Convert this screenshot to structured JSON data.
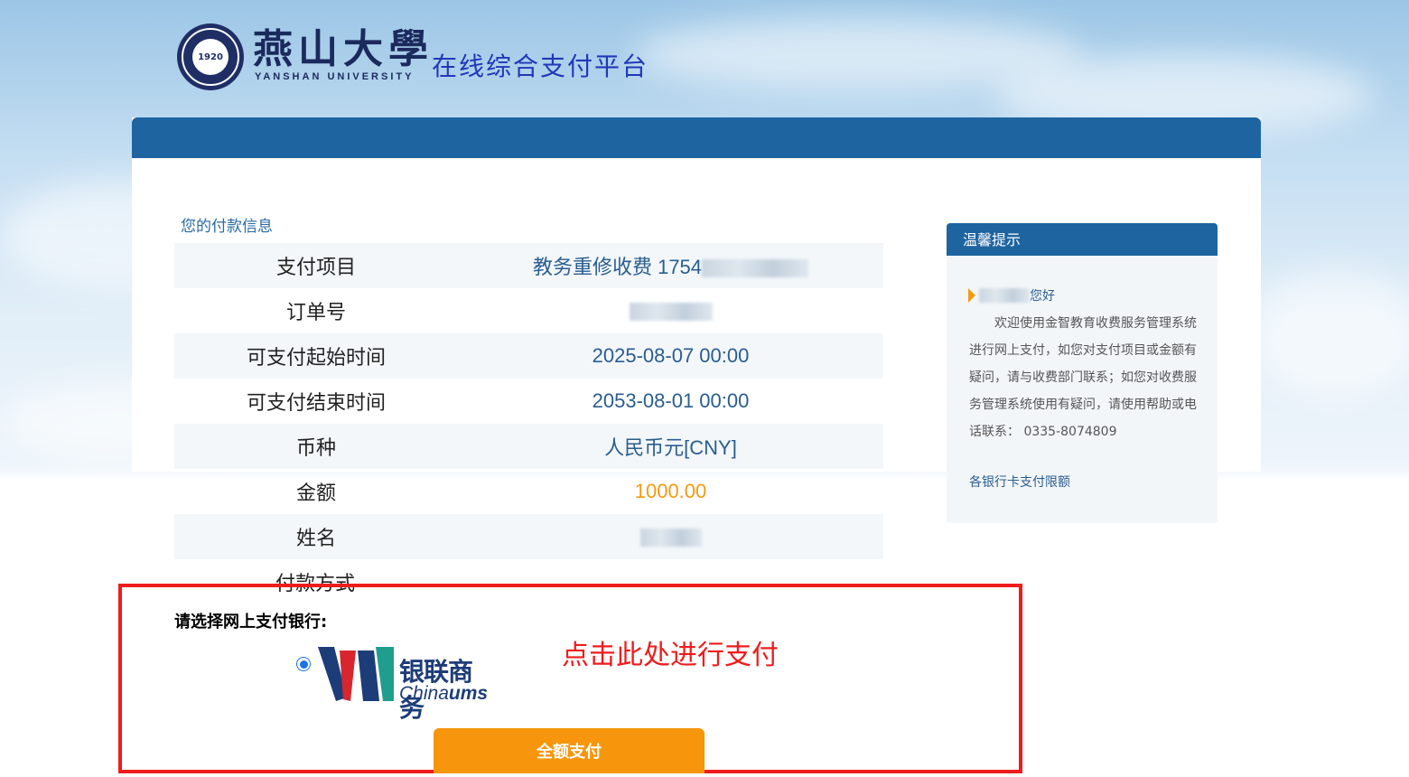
{
  "header": {
    "logo_cn": "燕山大學",
    "logo_en": "YANSHAN UNIVERSITY",
    "logo_year": "1920",
    "site_title": "在线综合支付平台"
  },
  "payment_info": {
    "section_title": "您的付款信息",
    "rows": [
      {
        "label": "支付项目",
        "value": "教务重修收费 1754"
      },
      {
        "label": "订单号",
        "value": ""
      },
      {
        "label": "可支付起始时间",
        "value": "2025-08-07 00:00"
      },
      {
        "label": "可支付结束时间",
        "value": "2053-08-01 00:00"
      },
      {
        "label": "币种",
        "value": "人民币元[CNY]"
      },
      {
        "label": "金额",
        "value": "1000.00"
      },
      {
        "label": "姓名",
        "value": ""
      }
    ],
    "payment_method_label": "付款方式"
  },
  "tips": {
    "title": "温馨提示",
    "greeting": "您好",
    "body": "欢迎使用金智教育收费服务管理系统进行网上支付，如您对支付项目或金额有疑问，请与收费部门联系；如您对收费服务管理系统使用有疑问，请使用帮助或电话联系： 0335-8074809",
    "link": "各银行卡支付限额"
  },
  "bank_selection": {
    "prompt": "请选择网上支付银行:",
    "annotation": "点击此处进行支付",
    "bank_name_cn": "银联商务",
    "bank_name_en_prefix": "China",
    "bank_name_en_suffix": "ums",
    "selected": true
  },
  "pay_button_label": "全额支付",
  "colors": {
    "primary_blue": "#1e64a0",
    "amount_orange": "#f29c11",
    "button_orange": "#f7960c",
    "highlight_red": "#ee1c1c"
  }
}
